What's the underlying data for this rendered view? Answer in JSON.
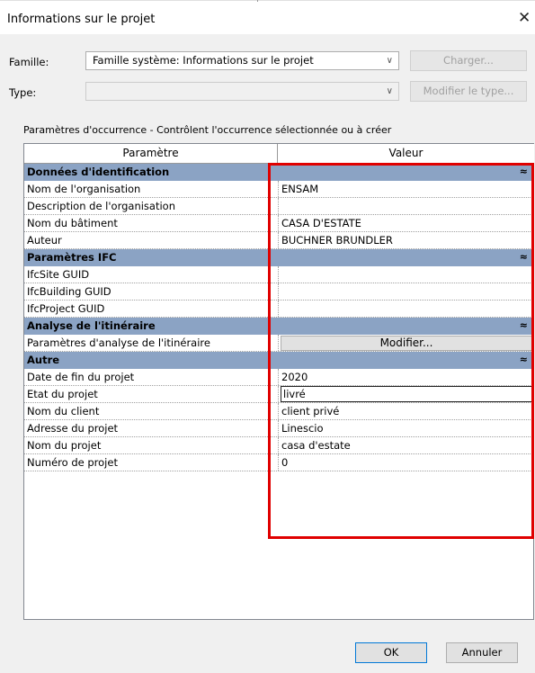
{
  "dialog": {
    "title": "Informations sur le projet",
    "close_glyph": "✕"
  },
  "famille": {
    "label": "Famille:",
    "value": "Famille système: Informations sur le projet",
    "load_button": "Charger..."
  },
  "type": {
    "label": "Type:",
    "value": "",
    "edit_type_button": "Modifier le type..."
  },
  "occurrence_label": "Paramètres d'occurrence - Contrôlent l'occurrence sélectionnée ou à créer",
  "grid": {
    "col_param": "Paramètre",
    "col_value": "Valeur",
    "rows": [
      {
        "kind": "group",
        "label": "Données d'identification"
      },
      {
        "kind": "param",
        "label": "Nom de l'organisation",
        "value": "ENSAM"
      },
      {
        "kind": "param",
        "label": "Description de l'organisation",
        "value": ""
      },
      {
        "kind": "param",
        "label": "Nom du bâtiment",
        "value": "CASA D'ESTATE"
      },
      {
        "kind": "param",
        "label": "Auteur",
        "value": "BUCHNER BRUNDLER"
      },
      {
        "kind": "group",
        "label": "Paramètres IFC"
      },
      {
        "kind": "param",
        "label": "IfcSite GUID",
        "value": ""
      },
      {
        "kind": "param",
        "label": "IfcBuilding GUID",
        "value": ""
      },
      {
        "kind": "param",
        "label": "IfcProject GUID",
        "value": ""
      },
      {
        "kind": "group",
        "label": "Analyse de l'itinéraire"
      },
      {
        "kind": "button",
        "label": "Paramètres d'analyse de l'itinéraire",
        "value": "Modifier..."
      },
      {
        "kind": "group",
        "label": "Autre"
      },
      {
        "kind": "param",
        "label": "Date de fin du projet",
        "value": "2020"
      },
      {
        "kind": "edit",
        "label": "Etat du projet",
        "value": "livré"
      },
      {
        "kind": "param",
        "label": "Nom du client",
        "value": "client privé"
      },
      {
        "kind": "param",
        "label": "Adresse du projet",
        "value": "Linescio"
      },
      {
        "kind": "param",
        "label": "Nom du projet",
        "value": "casa d'estate"
      },
      {
        "kind": "param",
        "label": "Numéro de projet",
        "value": "0"
      }
    ],
    "collapse_glyph": "≈"
  },
  "footer": {
    "ok": "OK",
    "cancel": "Annuler"
  },
  "colors": {
    "group_header": "#8ba3c4",
    "highlight": "#e00000",
    "default_button_border": "#0078d7"
  }
}
